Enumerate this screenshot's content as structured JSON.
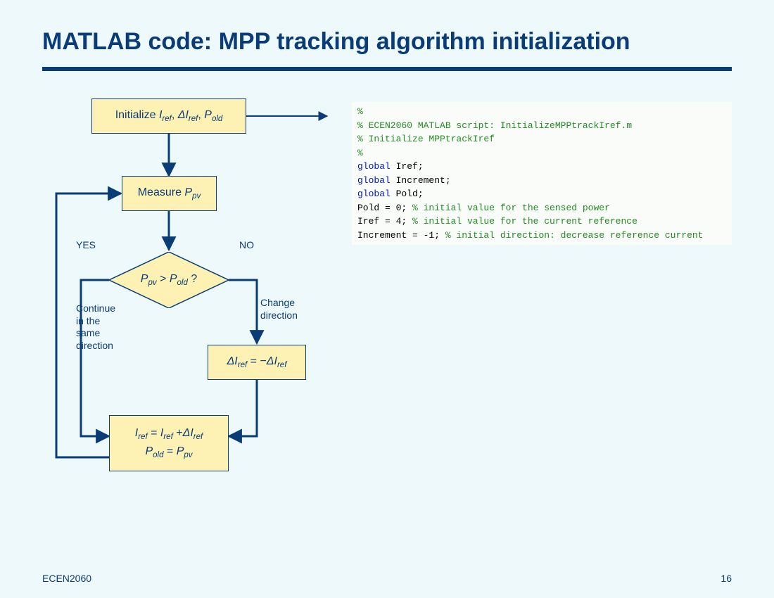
{
  "title": "MATLAB code: MPP tracking algorithm initialization",
  "footer": {
    "left": "ECEN2060",
    "right": "16"
  },
  "flow": {
    "init_prefix": "Initialize ",
    "init_i": "I",
    "init_i_sub": "ref",
    "init_sep1": ", ",
    "init_di": "ΔI",
    "init_di_sub": "ref",
    "init_sep2": ", ",
    "init_p": "P",
    "init_p_sub": "old",
    "measure_prefix": "Measure ",
    "measure_p": "P",
    "measure_p_sub": "pv",
    "dec_p1": "P",
    "dec_p1_sub": "pv",
    "dec_gt": " > ",
    "dec_p2": "P",
    "dec_p2_sub": "old",
    "dec_q": " ?",
    "yes": "YES",
    "no": "NO",
    "continue_txt": "Continue\nin the\nsame\ndirection",
    "change_txt": "Change\ndirection",
    "neg_di1": "ΔI",
    "neg_di1_sub": "ref",
    "neg_eq": " = −",
    "neg_di2": "ΔI",
    "neg_di2_sub": "ref",
    "upd1_i1": "I",
    "upd1_i1_sub": "ref",
    "upd1_eq": " = ",
    "upd1_i2": "I",
    "upd1_i2_sub": "ref",
    "upd1_plus": " +",
    "upd1_di": "ΔI",
    "upd1_di_sub": "ref",
    "upd2_p1": "P",
    "upd2_p1_sub": "old",
    "upd2_eq": " = ",
    "upd2_p2": "P",
    "upd2_p2_sub": "pv"
  },
  "code": {
    "l1": "%",
    "l2": "% ECEN2060 MATLAB script: InitializeMPPtrackIref.m",
    "l3": "% Initialize MPPtrackIref",
    "l4": "%",
    "l5k": "global",
    "l5t": " Iref;",
    "l6k": "global",
    "l6t": " Increment;",
    "l7k": "global",
    "l7t": " Pold;",
    "l8a": "Pold = 0; ",
    "l8b": "% initial value for the sensed power",
    "l9a": "Iref = 4; ",
    "l9b": "% initial value for the current reference",
    "l10a": "Increment = -1; ",
    "l10b": "% initial direction: decrease reference current"
  }
}
